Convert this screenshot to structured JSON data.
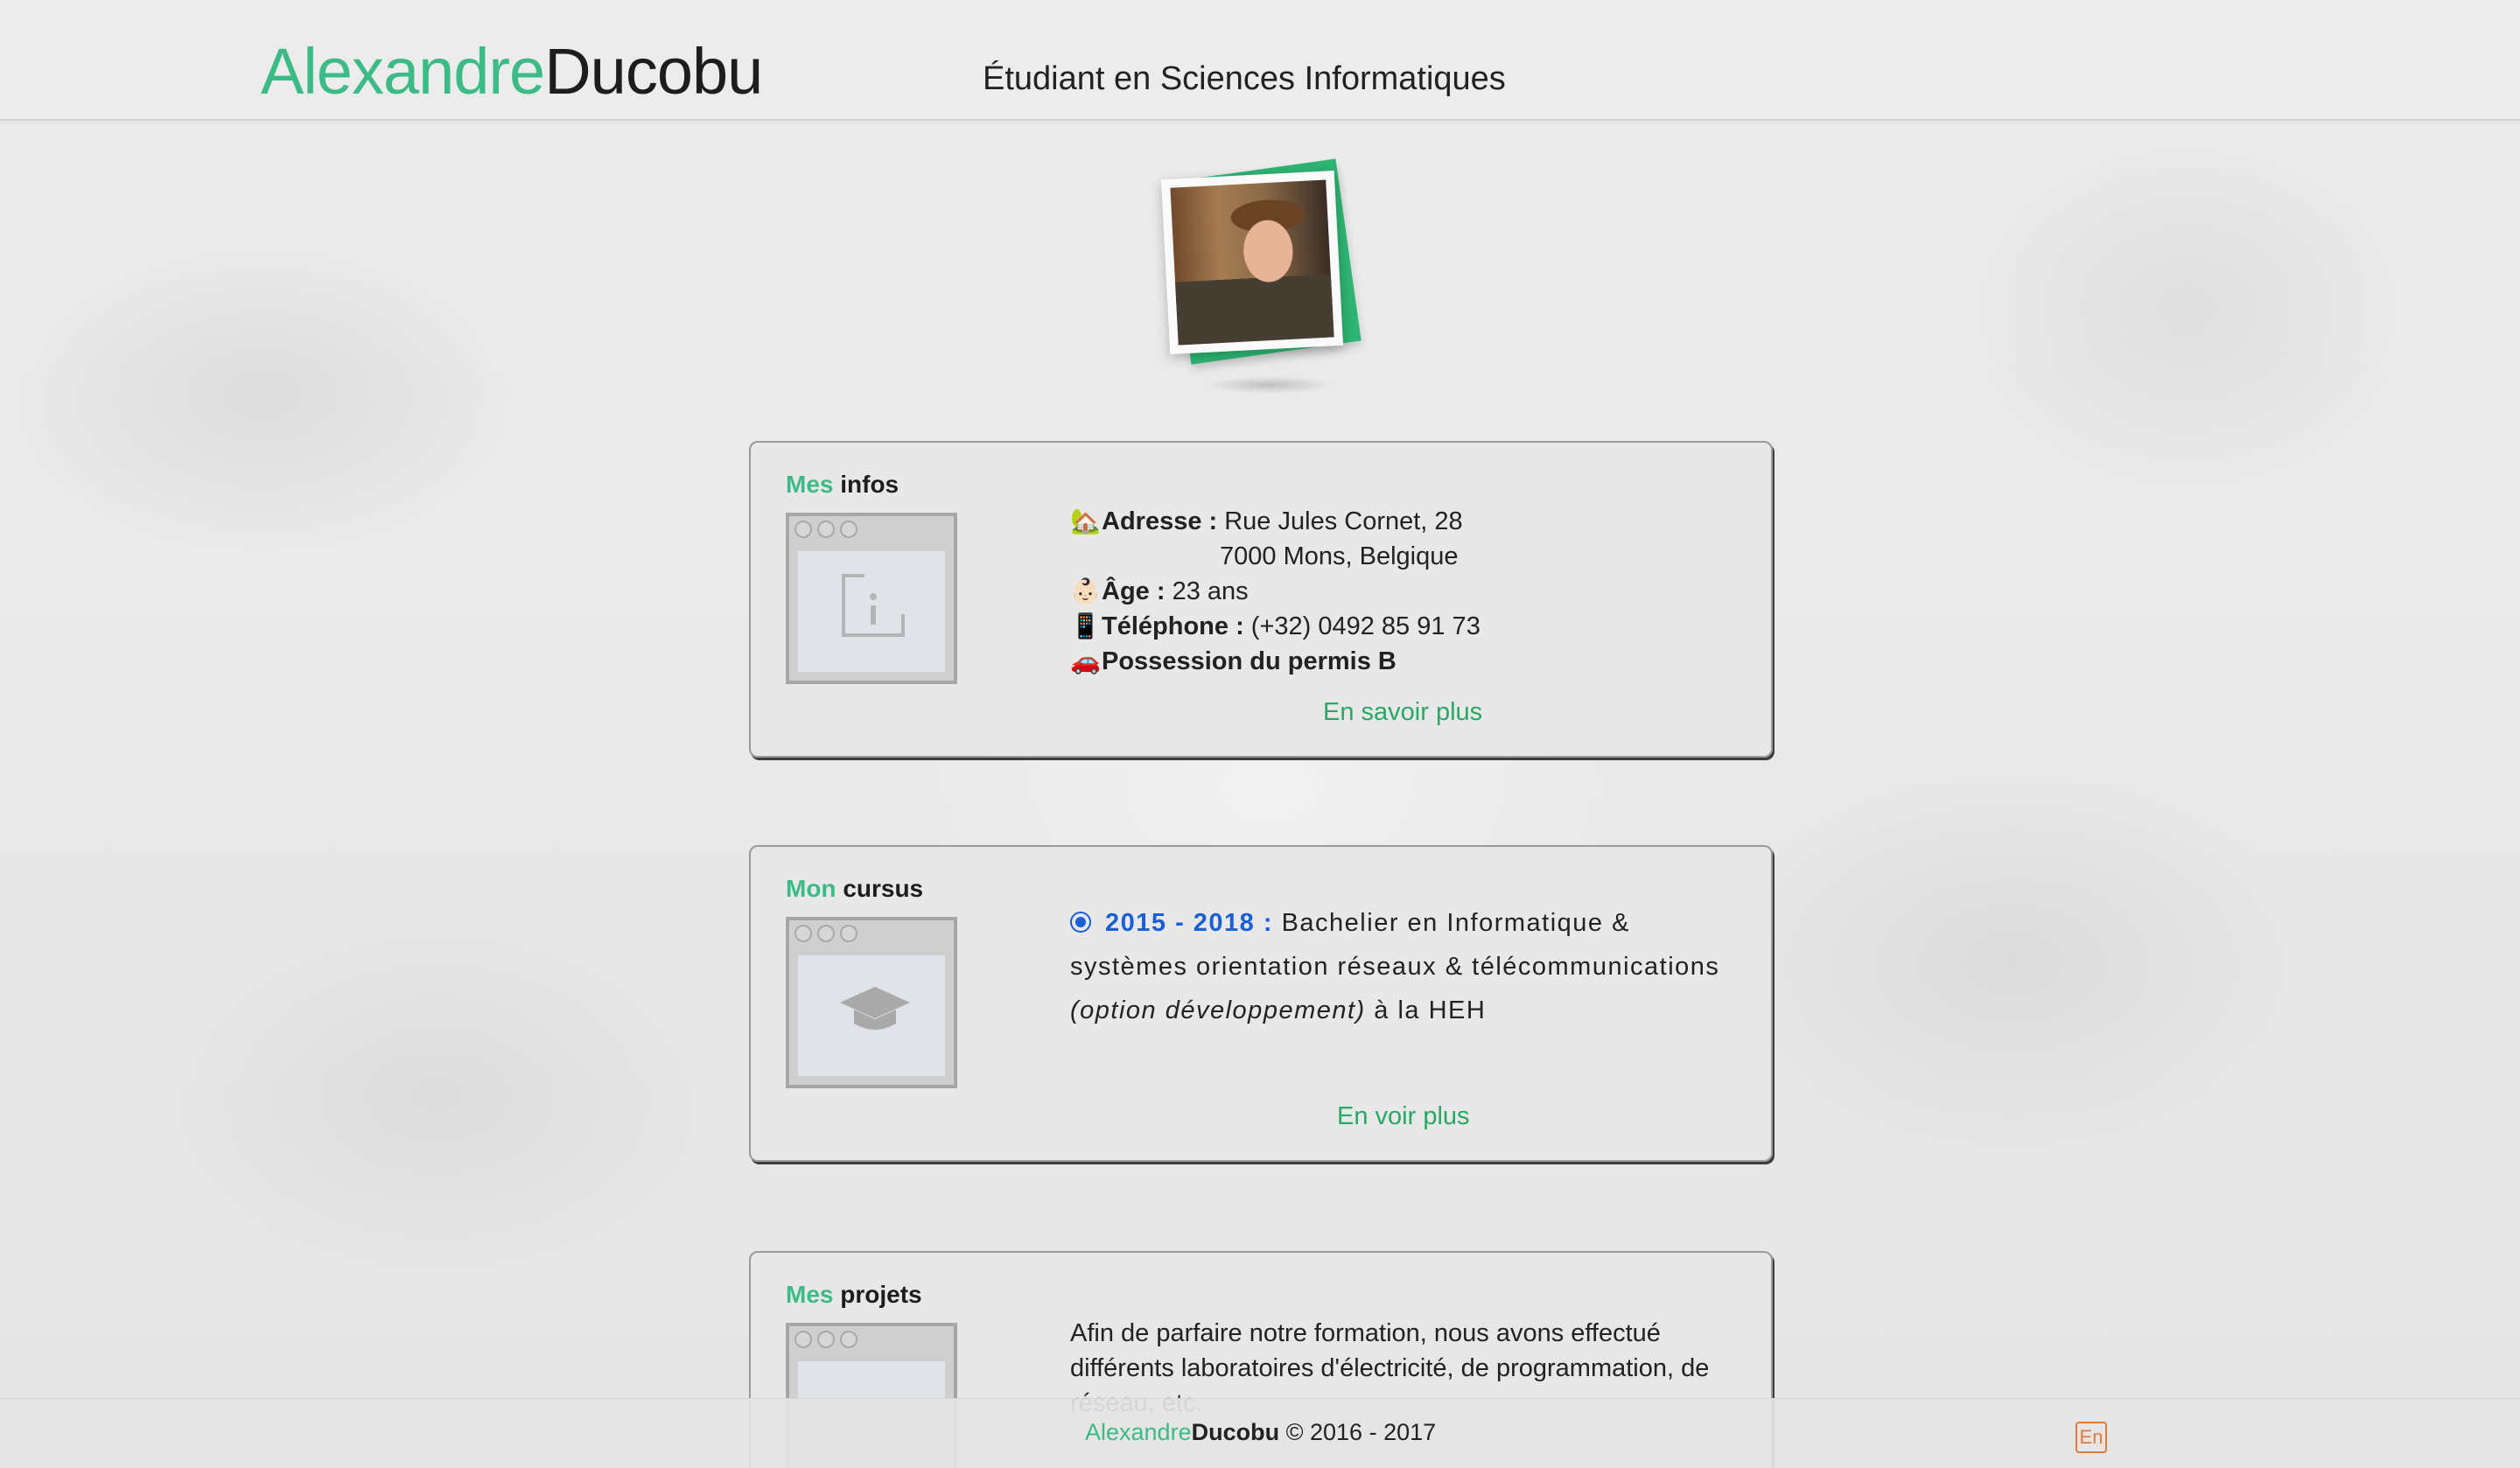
{
  "header": {
    "logo_first": "Alexandre",
    "logo_last": "Ducobu",
    "subtitle": "Étudiant en Sciences Informatiques"
  },
  "infos": {
    "title_w1": "Mes",
    "title_w2": "infos",
    "address_label": "Adresse :",
    "address_line1": "Rue Jules Cornet, 28",
    "address_line2": "7000 Mons, Belgique",
    "age_label": "Âge :",
    "age_value": "23 ans",
    "phone_label": "Téléphone :",
    "phone_value": "(+32) 0492 85 91 73",
    "license": "Possession du permis B",
    "more": "En savoir plus"
  },
  "cursus": {
    "title_w1": "Mon",
    "title_w2": "cursus",
    "years": "2015 - 2018 :",
    "text_a": "Bachelier en Informatique & systèmes orientation réseaux & télécommunications",
    "text_option": "(option développement)",
    "text_b": "à la HEH",
    "more": "En voir plus"
  },
  "projets": {
    "title_w1": "Mes",
    "title_w2": "projets",
    "text": "Afin de parfaire notre formation, nous avons effectué différents laboratoires d'électricité, de programmation, de réseau, etc."
  },
  "footer": {
    "first": "Alexandre",
    "last": "Ducobu",
    "copyright": "© 2016 - 2017",
    "lang": "En"
  },
  "icons": {
    "house": "🏡",
    "face": "👶🏻",
    "phone": "📱",
    "car": "🚗"
  },
  "colors": {
    "accent": "#3dbb86",
    "link": "#27a865",
    "year": "#1b5fd6",
    "lang": "#e07a3a"
  }
}
